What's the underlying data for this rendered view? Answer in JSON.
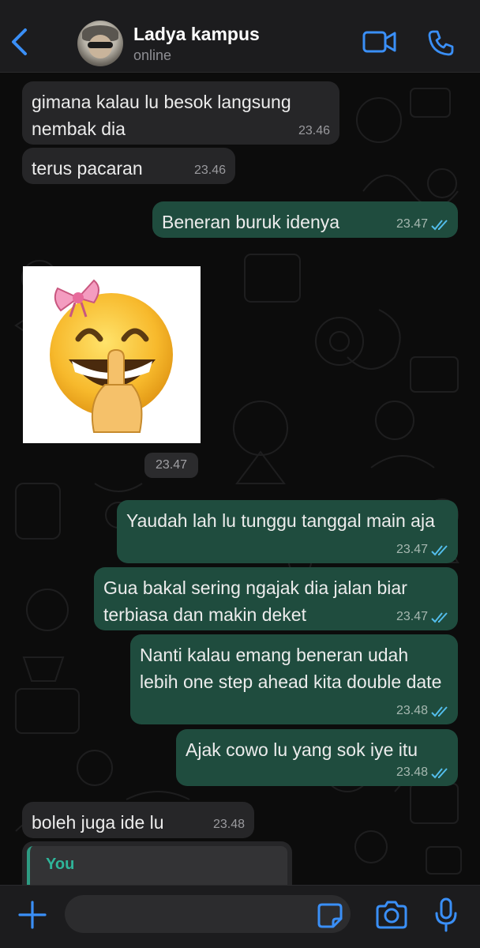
{
  "header": {
    "contact_name": "Ladya kampus",
    "status": "online",
    "icons": {
      "back": "chevron-left-icon",
      "video": "video-camera-icon",
      "call": "phone-icon"
    },
    "accent_color": "#3a8ff7"
  },
  "messages": [
    {
      "direction": "incoming",
      "text": "gimana kalau lu besok langsung nembak dia",
      "time": "23.46"
    },
    {
      "direction": "incoming",
      "text": "terus pacaran",
      "time": "23.46"
    },
    {
      "direction": "outgoing",
      "text": "Beneran buruk idenya",
      "time": "23.47",
      "read": true
    },
    {
      "direction": "incoming",
      "type": "sticker",
      "sticker": "grinning-face-with-bow-shush-emoji",
      "time": "23.47"
    },
    {
      "direction": "outgoing",
      "text": "Yaudah lah lu tunggu tanggal main aja",
      "time": "23.47",
      "read": true
    },
    {
      "direction": "outgoing",
      "text": "Gua bakal sering ngajak dia jalan biar terbiasa dan makin deket",
      "time": "23.47",
      "read": true
    },
    {
      "direction": "outgoing",
      "text": "Nanti kalau emang beneran udah lebih one step ahead kita double date",
      "time": "23.48",
      "read": true
    },
    {
      "direction": "outgoing",
      "text": "Ajak cowo lu yang sok iye itu",
      "time": "23.48",
      "read": true
    },
    {
      "direction": "incoming",
      "text": "boleh juga ide lu",
      "time": "23.48"
    },
    {
      "direction": "incoming",
      "type": "reply",
      "reply_sender": "You"
    }
  ],
  "colors": {
    "incoming_bubble": "#262628",
    "outgoing_bubble": "#1f4c3e",
    "read_ticks": "#53bdeb",
    "reply_accent": "#2fb59a"
  },
  "input_bar": {
    "message_value": "",
    "icons": {
      "add": "plus-icon",
      "sticker": "sticker-icon",
      "camera": "camera-icon",
      "mic": "microphone-icon"
    }
  }
}
